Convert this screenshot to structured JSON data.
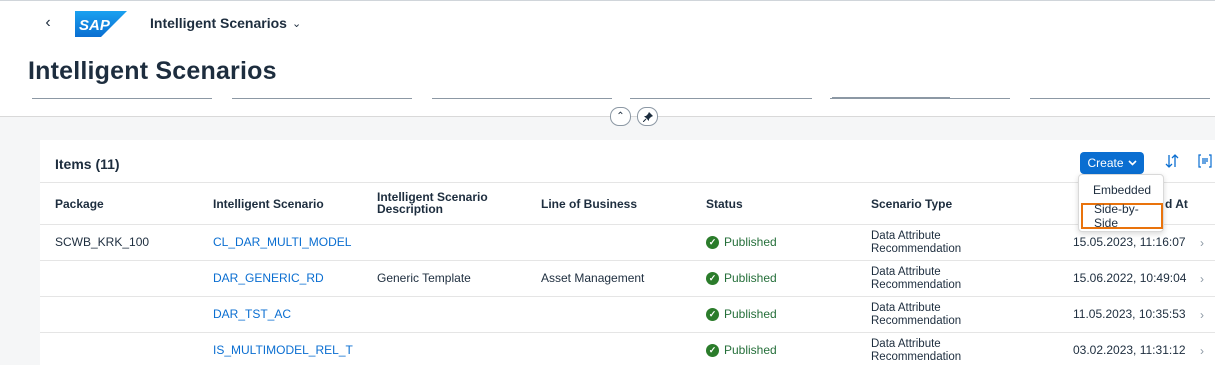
{
  "shell": {
    "back_glyph": "‹",
    "logo_text": "SAP",
    "app_title": "Intelligent Scenarios",
    "app_title_chevron": "⌄"
  },
  "page": {
    "title": "Intelligent Scenarios"
  },
  "header_controls": {
    "collapse_glyph": "⌃",
    "pin_glyph": "📌"
  },
  "table": {
    "title": "Items (11)",
    "create_label": "Create",
    "columns": [
      "Package",
      "Intelligent Scenario",
      "Intelligent Scenario Description",
      "Line of Business",
      "Status",
      "Scenario Type",
      "d At"
    ],
    "rows": [
      {
        "package": "SCWB_KRK_100",
        "scenario": "CL_DAR_MULTI_MODEL",
        "description": "",
        "lob": "",
        "status": "Published",
        "type_line1": "Data Attribute",
        "type_line2": "Recommendation",
        "changed_at": "15.05.2023, 11:16:07"
      },
      {
        "package": "",
        "scenario": "DAR_GENERIC_RD",
        "description": "Generic Template",
        "lob": "Asset Management",
        "status": "Published",
        "type_line1": "Data Attribute",
        "type_line2": "Recommendation",
        "changed_at": "15.06.2022, 10:49:04"
      },
      {
        "package": "",
        "scenario": "DAR_TST_AC",
        "description": "",
        "lob": "",
        "status": "Published",
        "type_line1": "Data Attribute",
        "type_line2": "Recommendation",
        "changed_at": "11.05.2023, 10:35:53"
      },
      {
        "package": "",
        "scenario": "IS_MULTIMODEL_REL_T",
        "description": "",
        "lob": "",
        "status": "Published",
        "type_line1": "Data Attribute",
        "type_line2": "Recommendation",
        "changed_at": "03.02.2023, 11:31:12"
      }
    ]
  },
  "create_menu": {
    "items": [
      "Embedded",
      "Side-by-Side"
    ]
  },
  "colors": {
    "brand_blue": "#0a6ed1",
    "status_green": "#2b7c2b",
    "highlight_orange": "#e9730c"
  }
}
